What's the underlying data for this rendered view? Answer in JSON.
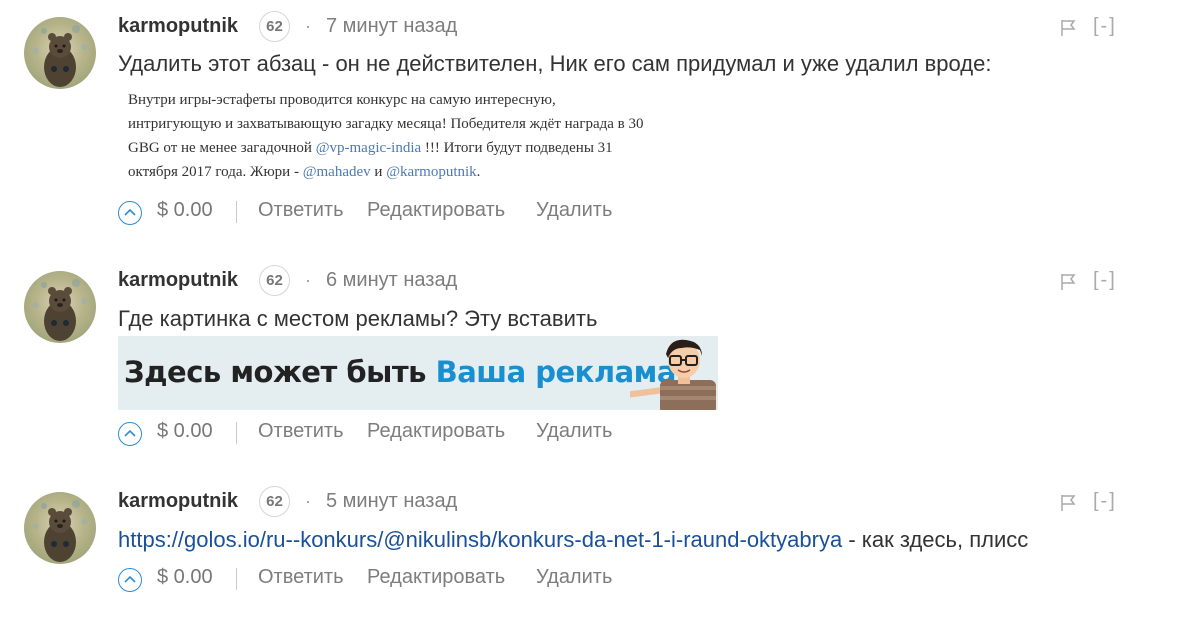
{
  "comments": [
    {
      "author": "karmoputnik",
      "reputation": "62",
      "separator": "·",
      "time": "7 минут назад",
      "collapse": "[-]",
      "text": "Удалить этот абзац - он не действителен, Ник его сам придумал и уже удалил вроде:",
      "quote": {
        "line1": "Внутри игры-эстафеты проводится конкурс на самую интересную,",
        "line2": "интригующую и захватывающую загадку месяца! Победителя ждёт награда в 30",
        "line3_pre": "GBG от не менее загадочной ",
        "line3_link": "@vp-magic-india",
        "line3_post": " !!! Итоги будут подведены 31",
        "line4_pre": "октября 2017 года. Жюри - ",
        "line4_link1": "@mahadev",
        "line4_mid": " и ",
        "line4_link2": "@karmoputnik",
        "line4_post": "."
      },
      "payout": "$ 0.00",
      "reply": "Ответить",
      "edit": "Редактировать",
      "delete": "Удалить"
    },
    {
      "author": "karmoputnik",
      "reputation": "62",
      "separator": "·",
      "time": "6 минут назад",
      "collapse": "[-]",
      "text": "Где картинка с местом рекламы? Эту вставить",
      "ad": {
        "text_main": "Здесь может быть ",
        "text_accent": "Ваша реклама"
      },
      "payout": "$ 0.00",
      "reply": "Ответить",
      "edit": "Редактировать",
      "delete": "Удалить"
    },
    {
      "author": "karmoputnik",
      "reputation": "62",
      "separator": "·",
      "time": "5 минут назад",
      "collapse": "[-]",
      "link": "https://golos.io/ru--konkurs/@nikulinsb/konkurs-da-net-1-i-raund-oktyabrya",
      "text_after_link": " - как здесь, плисс",
      "payout": "$ 0.00",
      "reply": "Ответить",
      "edit": "Редактировать",
      "delete": "Удалить"
    }
  ],
  "colors": {
    "link": "#1a5099",
    "accent": "#1a8fcf",
    "vote": "#2b8bd6",
    "muted": "#7d7d7d"
  },
  "icons": [
    "avatar-bear",
    "flag-icon",
    "upvote-icon"
  ]
}
